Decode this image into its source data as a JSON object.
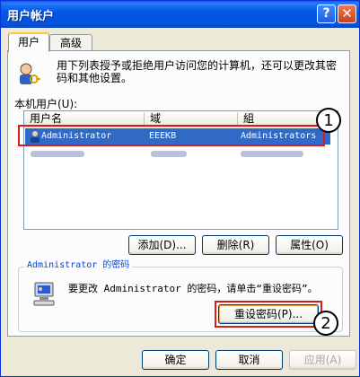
{
  "window": {
    "title": "用户帐户",
    "help_label": "?",
    "close_label": "✕"
  },
  "tabs": [
    {
      "label": "用户",
      "selected": true
    },
    {
      "label": "高级",
      "selected": false
    }
  ],
  "intro_text": "用下列表授予或拒绝用户访问您的计算机，还可以更改其密码和其他设置。",
  "local_users_label": "本机用户(U):",
  "list": {
    "columns": [
      "用户名",
      "域",
      "組"
    ],
    "rows": [
      {
        "user": "Administrator",
        "domain": "EEEKB",
        "group": "Administrators",
        "selected": true
      }
    ]
  },
  "list_buttons": {
    "add": "添加(D)...",
    "delete": "删除(R)",
    "properties": "属性(O)"
  },
  "password_group": {
    "legend": "Administrator 的密码",
    "text": "要更改 Administrator 的密码，请单击“重设密码”。",
    "reset_button": "重设密码(P)..."
  },
  "dialog_buttons": {
    "ok": "确定",
    "cancel": "取消",
    "apply": "应用(A)"
  },
  "annotations": {
    "badge1": "1",
    "badge2": "2"
  },
  "colors": {
    "title_bar": "#0058e6",
    "selection": "#316ac5",
    "highlight": "#d81c1c"
  }
}
